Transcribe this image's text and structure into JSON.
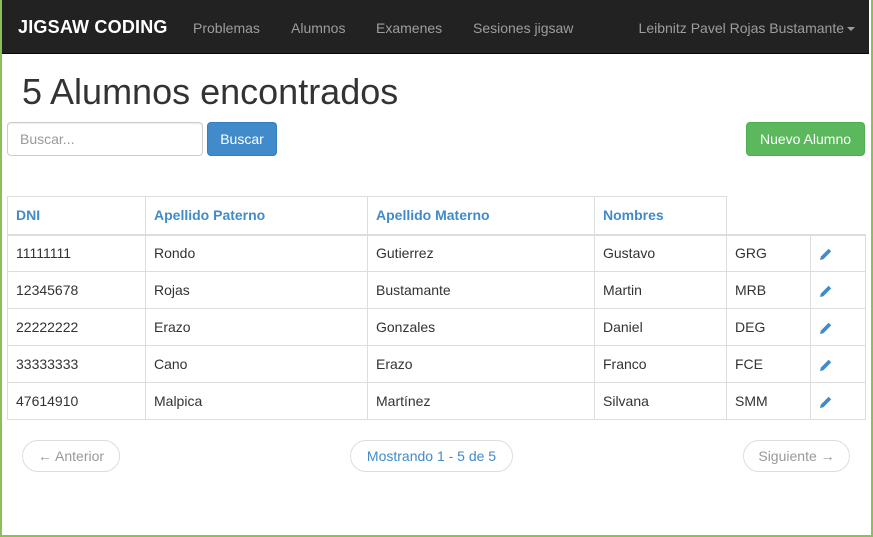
{
  "navbar": {
    "brand": "JIGSAW CODING",
    "links": [
      "Problemas",
      "Alumnos",
      "Examenes",
      "Sesiones jigsaw"
    ],
    "user": "Leibnitz Pavel Rojas Bustamante"
  },
  "page": {
    "title": "5 Alumnos encontrados"
  },
  "search": {
    "placeholder": "Buscar...",
    "value": "",
    "button": "Buscar"
  },
  "actions": {
    "new_student": "Nuevo Alumno"
  },
  "table": {
    "headers": [
      "DNI",
      "Apellido Paterno",
      "Apellido Materno",
      "Nombres"
    ],
    "rows": [
      [
        "11111111",
        "Rondo",
        "Gutierrez",
        "Gustavo",
        "GRG"
      ],
      [
        "12345678",
        "Rojas",
        "Bustamante",
        "Martin",
        "MRB"
      ],
      [
        "22222222",
        "Erazo",
        "Gonzales",
        "Daniel",
        "DEG"
      ],
      [
        "33333333",
        "Cano",
        "Erazo",
        "Franco",
        "FCE"
      ],
      [
        "47614910",
        "Malpica",
        "Martínez",
        "Silvana",
        "SMM"
      ]
    ]
  },
  "pagination": {
    "prev": "← Anterior",
    "info": "Mostrando 1 - 5 de 5",
    "next": "Siguiente →"
  },
  "colors": {
    "navbar_bg": "#222222",
    "primary": "#428bca",
    "success": "#5cb85c",
    "frame": "#8cbf5a"
  },
  "icons": {
    "row_action": "pencil-icon",
    "user_menu": "caret-down-icon"
  }
}
